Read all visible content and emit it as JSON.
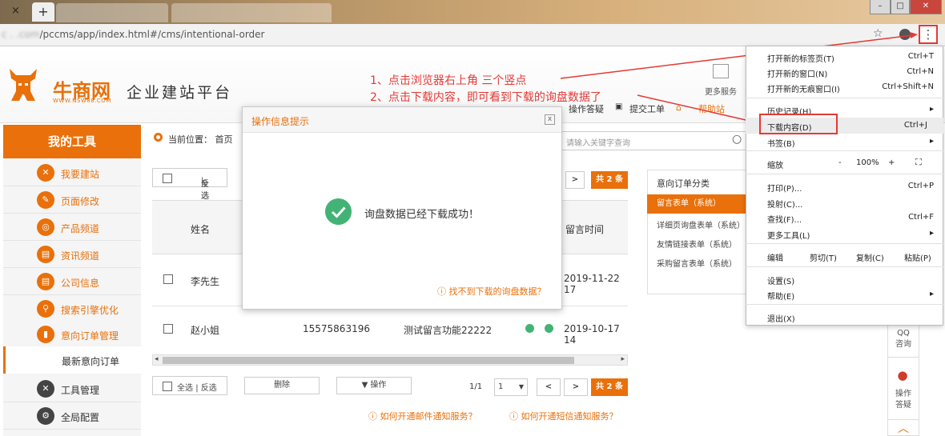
{
  "browser": {
    "close_glyph": "×",
    "new_tab_glyph": "+",
    "url": "/pccms/app/index.html#/cms/intentional-order",
    "url_prefix_blurred": "c   .        .com",
    "menu_glyph": "⋮",
    "star_glyph": "☆",
    "profile_glyph": "●",
    "win_min": "–",
    "win_max": "□",
    "win_close": "✕"
  },
  "header": {
    "logo_text": "牛商网",
    "logo_url": "WWW.NSW88.COM",
    "slogan": "企业建站平台",
    "more_services": "更多服务",
    "links": [
      "操作答疑",
      "提交工单",
      "帮助站"
    ]
  },
  "sidebar": {
    "title": "我的工具",
    "items": [
      {
        "label": "我要建站",
        "icon": "tools-icon"
      },
      {
        "label": "页面修改",
        "icon": "pencil-icon"
      },
      {
        "label": "产品频道",
        "icon": "product-icon"
      },
      {
        "label": "资讯频道",
        "icon": "news-icon"
      },
      {
        "label": "公司信息",
        "icon": "company-icon"
      },
      {
        "label": "搜索引擎优化",
        "icon": "search-icon"
      },
      {
        "label": "意向订单管理",
        "icon": "order-icon"
      }
    ],
    "sub_item": "最新意向订单",
    "bottom_items": [
      {
        "label": "工具管理",
        "icon": "wrench-icon"
      },
      {
        "label": "全局配置",
        "icon": "settings-icon"
      }
    ]
  },
  "breadcrumb": {
    "label": "当前位置：",
    "home": "首页"
  },
  "search": {
    "placeholder": "请输入关键字查询"
  },
  "table": {
    "select_all": "全选",
    "separator": "|",
    "invert": "反选",
    "col_name": "姓名",
    "col_time": "留言时间",
    "total_badge": "共 2 条",
    "rows": [
      {
        "name": "李先生",
        "phone": "",
        "content": "",
        "time": "2019-11-22 17"
      },
      {
        "name": "赵小姐",
        "phone": "15575863196",
        "content": "测试留言功能22222",
        "time": "2019-10-17 14"
      }
    ],
    "delete": "删除",
    "operate": "▼ 操作",
    "page_info": "1/1",
    "page_select": "1",
    "prev": "<",
    "next": ">",
    "help_email": "如何开通邮件通知服务？",
    "help_sms": "如何开通短信通知服务？"
  },
  "category": {
    "title": "意向订单分类",
    "items": [
      "留言表单（系统）",
      "详细页询盘表单（系统）",
      "友情链接表单（系统）",
      "采购留言表单（系统）"
    ]
  },
  "float_bar": {
    "qq1": "QQ",
    "qq2": "咨询",
    "op1": "操作",
    "op2": "答疑"
  },
  "modal": {
    "title": "操作信息提示",
    "close": "x",
    "message": "询盘数据已经下载成功！",
    "help": "找不到下载的询盘数据？"
  },
  "annotations": {
    "line1": "1、点击浏览器右上角 三个竖点",
    "line2": "2、点击下载内容，即可看到下载的询盘数据了"
  },
  "chrome_menu": {
    "new_tab": {
      "label": "打开新的标签页(T)",
      "shortcut": "Ctrl+T"
    },
    "new_window": {
      "label": "打开新的窗口(N)",
      "shortcut": "Ctrl+N"
    },
    "incognito": {
      "label": "打开新的无痕窗口(I)",
      "shortcut": "Ctrl+Shift+N"
    },
    "history": {
      "label": "历史记录(H)"
    },
    "downloads": {
      "label": "下载内容(D)",
      "shortcut": "Ctrl+J"
    },
    "bookmarks": {
      "label": "书签(B)"
    },
    "zoom": {
      "label": "缩放",
      "minus": "-",
      "value": "100%",
      "plus": "+",
      "fullscreen": "⛶"
    },
    "print": {
      "label": "打印(P)...",
      "shortcut": "Ctrl+P"
    },
    "cast": {
      "label": "投射(C)..."
    },
    "find": {
      "label": "查找(F)...",
      "shortcut": "Ctrl+F"
    },
    "more_tools": {
      "label": "更多工具(L)"
    },
    "edit": {
      "label": "编辑",
      "cut": "剪切(T)",
      "copy": "复制(C)",
      "paste": "粘贴(P)"
    },
    "settings": {
      "label": "设置(S)"
    },
    "help": {
      "label": "帮助(E)"
    },
    "exit": {
      "label": "退出(X)"
    }
  },
  "colors": {
    "accent": "#e9700a",
    "annotation": "#e53935",
    "success": "#43b375"
  }
}
